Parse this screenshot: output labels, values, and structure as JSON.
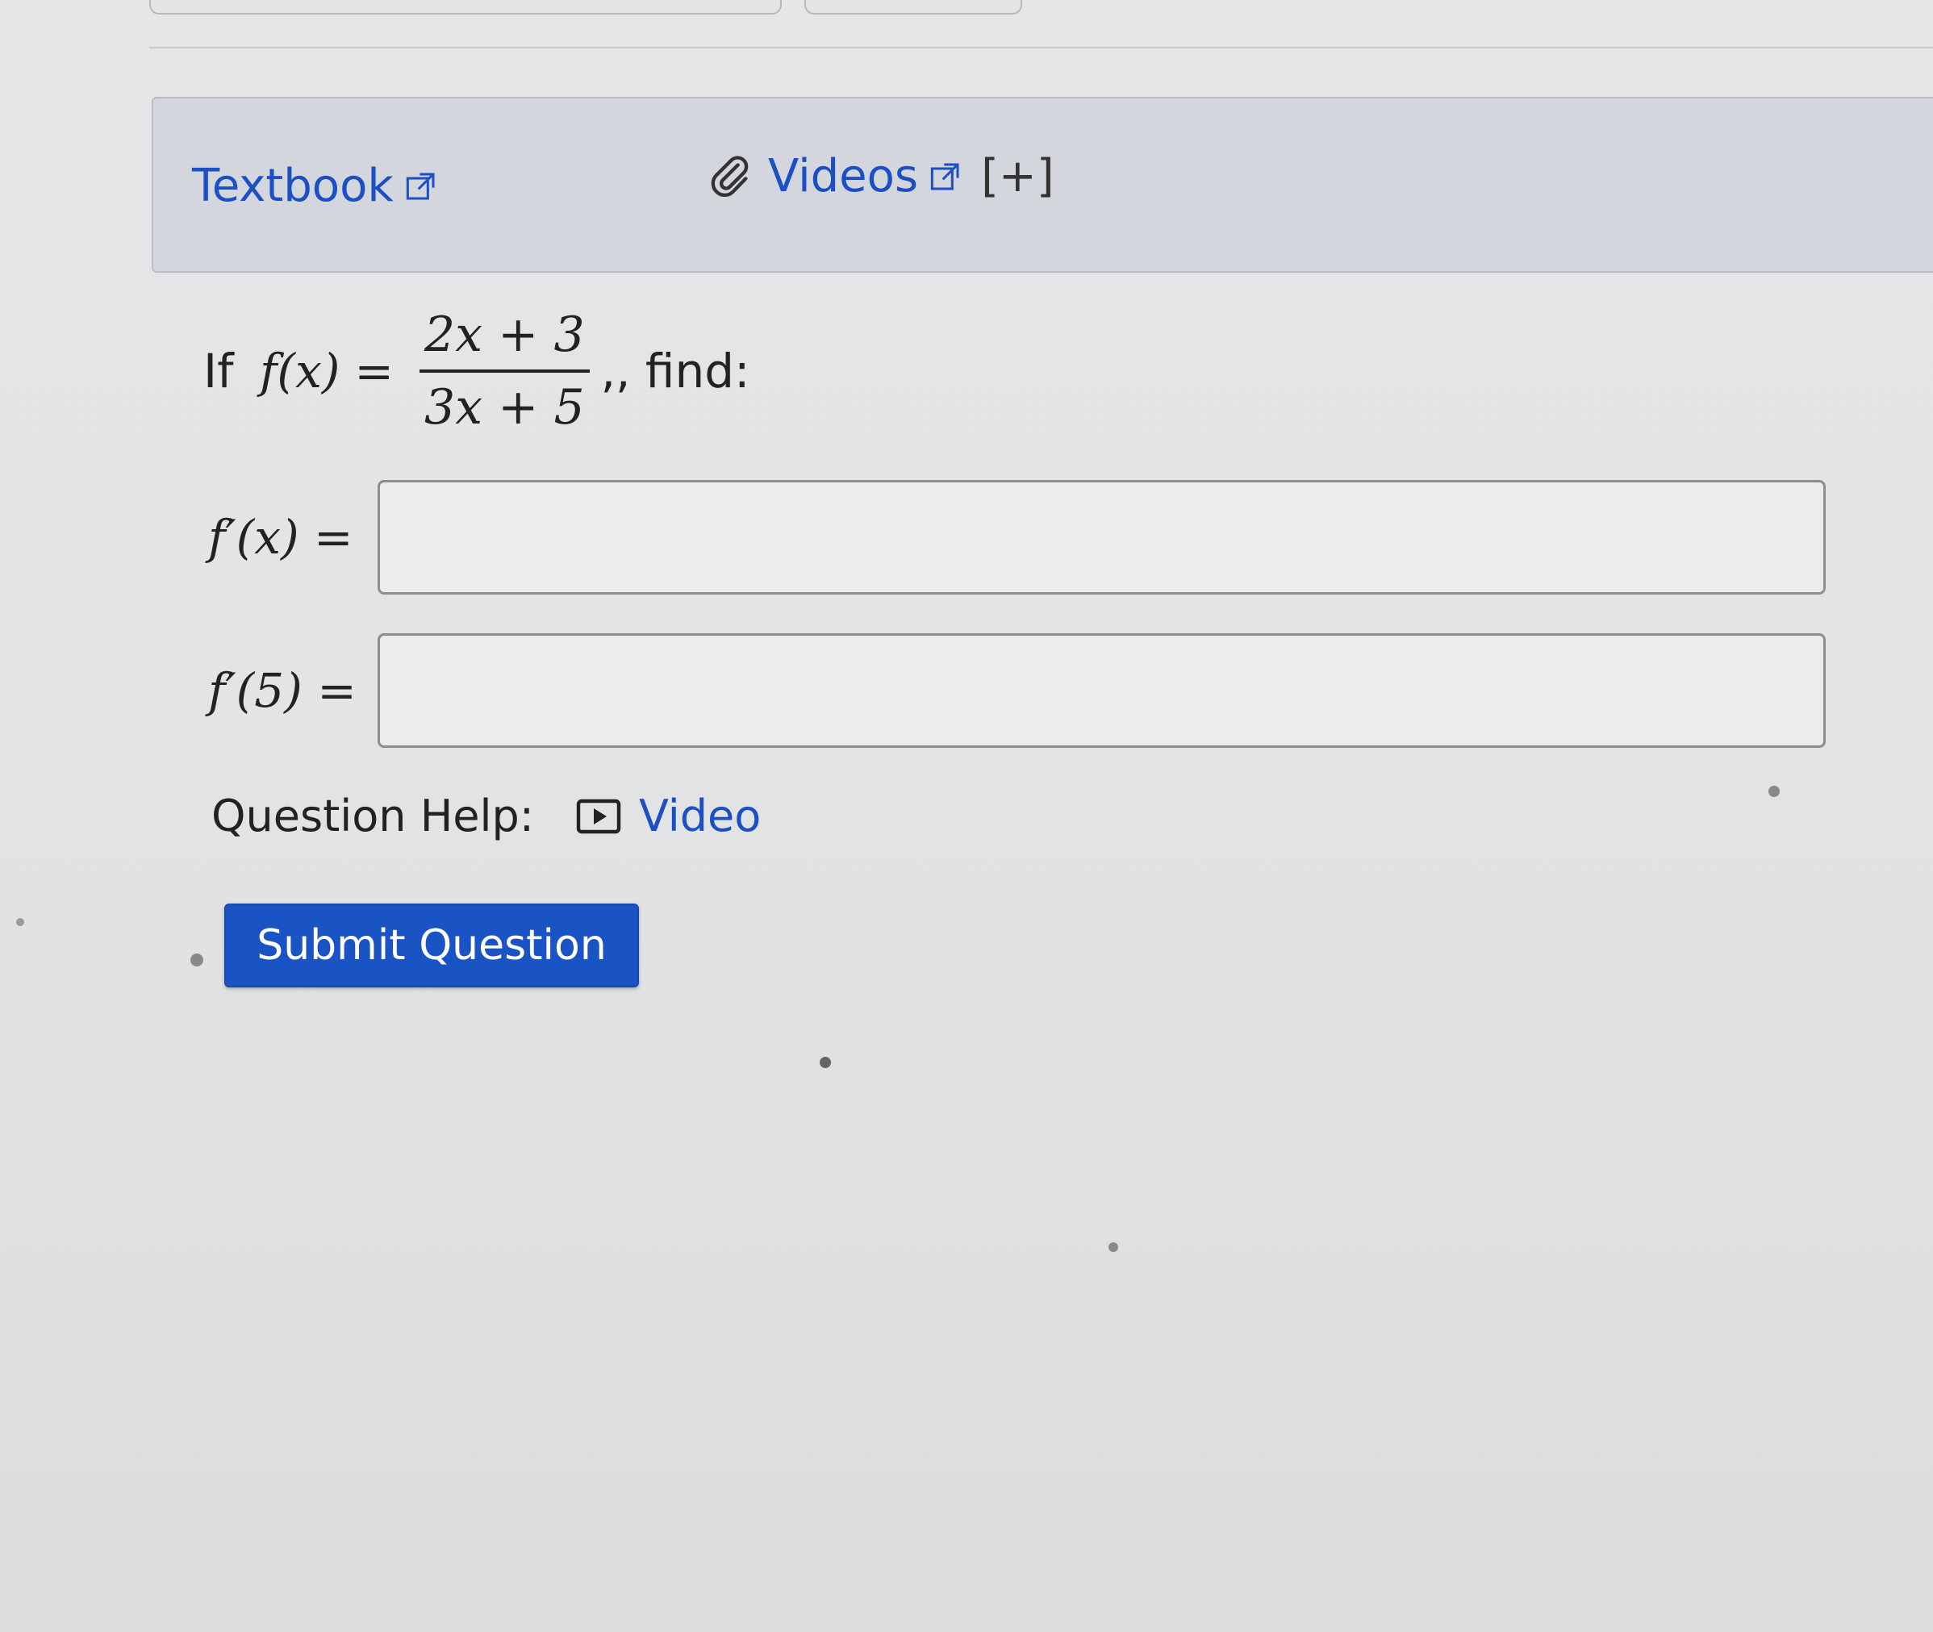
{
  "resources": {
    "textbook_label": "Textbook",
    "videos_label": "Videos",
    "expand_label": "[+]"
  },
  "question": {
    "prefix": "If ",
    "function_lhs": "f(x)",
    "equals": "=",
    "numerator": "2x + 3",
    "denominator": "3x + 5",
    "suffix": ",, find:"
  },
  "answers": [
    {
      "label": "f′(x) =",
      "value": "",
      "placeholder": ""
    },
    {
      "label": "f′(5) =",
      "value": "",
      "placeholder": ""
    }
  ],
  "help": {
    "label": "Question Help:",
    "video_label": "Video"
  },
  "submit": {
    "label": "Submit Question"
  },
  "colors": {
    "link": "#1d4fc4",
    "button": "#1a53c4",
    "panel": "#d3d6dc"
  },
  "icons": [
    "external-link-icon",
    "paperclip-icon",
    "play-video-icon"
  ]
}
